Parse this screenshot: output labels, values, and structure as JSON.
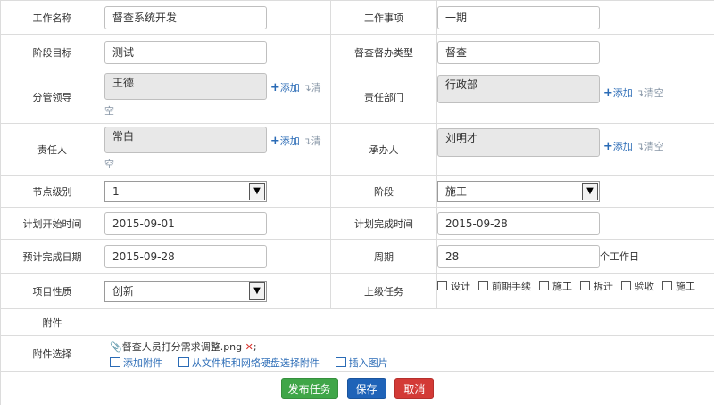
{
  "fields": {
    "work_name": {
      "label": "工作名称",
      "value": "督查系统开发"
    },
    "work_item": {
      "label": "工作事项",
      "value": "一期"
    },
    "stage_goal": {
      "label": "阶段目标",
      "value": "测试"
    },
    "supervise_type": {
      "label": "督查督办类型",
      "value": "督查"
    },
    "leader": {
      "label": "分管领导",
      "value": "王德"
    },
    "dept": {
      "label": "责任部门",
      "value": "行政部"
    },
    "owner": {
      "label": "责任人",
      "value": "常白"
    },
    "handler": {
      "label": "承办人",
      "value": "刘明才"
    },
    "node_level": {
      "label": "节点级别",
      "value": "1"
    },
    "stage": {
      "label": "阶段",
      "value": "施工"
    },
    "plan_start": {
      "label": "计划开始时间",
      "value": "2015-09-01"
    },
    "plan_end": {
      "label": "计划完成时间",
      "value": "2015-09-28"
    },
    "est_end": {
      "label": "预计完成日期",
      "value": "2015-09-28"
    },
    "period": {
      "label": "周期",
      "value": "28",
      "unit": "个工作日"
    },
    "nature": {
      "label": "项目性质",
      "value": "创新"
    },
    "parent_task": {
      "label": "上级任务",
      "options": [
        "设计",
        "前期手续",
        "施工",
        "拆迁",
        "验收",
        "施工"
      ]
    },
    "attachment": {
      "label": "附件"
    },
    "attachment_select": {
      "label": "附件选择",
      "file_name": "督查人员打分需求调整.png",
      "file_sep": ";",
      "add_label": "添加附件",
      "from_cabinet_label": "从文件柜和网络硬盘选择附件",
      "insert_image_label": "插入图片"
    }
  },
  "actions": {
    "add": "添加",
    "clear_split_a": "清",
    "clear_split_b": "空",
    "clear": "清空"
  },
  "buttons": {
    "publish": "发布任务",
    "save": "保存",
    "cancel": "取消"
  },
  "colors": {
    "link": "#2a6bb6",
    "publish": "#3fa648",
    "save": "#1f63b8",
    "cancel": "#d33a36",
    "readonly_bg": "#e8e8e8"
  }
}
